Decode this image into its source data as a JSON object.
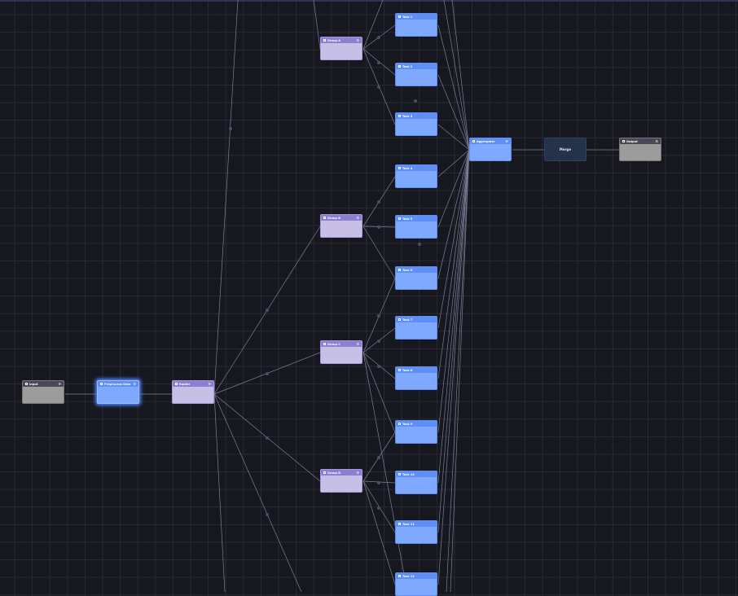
{
  "canvas": {
    "accent": "#5f8ef5",
    "background": "#17171f"
  },
  "nodes": {
    "input": {
      "title": "Input",
      "desc": ""
    },
    "preprocess": {
      "title": "Preprocess Data",
      "desc": ""
    },
    "router": {
      "title": "Router",
      "desc": ""
    },
    "group_a": {
      "title": "Group A",
      "desc": ""
    },
    "group_b": {
      "title": "Group B",
      "desc": ""
    },
    "group_c": {
      "title": "Group C",
      "desc": ""
    },
    "group_d": {
      "title": "Group D",
      "desc": ""
    },
    "task_1": {
      "title": "Task 1",
      "desc": ""
    },
    "task_2": {
      "title": "Task 2",
      "desc": ""
    },
    "task_3": {
      "title": "Task 3",
      "desc": ""
    },
    "task_4": {
      "title": "Task 4",
      "desc": ""
    },
    "task_5": {
      "title": "Task 5",
      "desc": ""
    },
    "task_6": {
      "title": "Task 6",
      "desc": ""
    },
    "task_7": {
      "title": "Task 7",
      "desc": ""
    },
    "task_8": {
      "title": "Task 8",
      "desc": ""
    },
    "task_9": {
      "title": "Task 9",
      "desc": ""
    },
    "task_10": {
      "title": "Task 10",
      "desc": ""
    },
    "task_11": {
      "title": "Task 11",
      "desc": ""
    },
    "task_12": {
      "title": "Task 12",
      "desc": ""
    },
    "aggregator": {
      "title": "Aggregator",
      "desc": ""
    },
    "merge": {
      "title": "Merge",
      "desc": ""
    },
    "output": {
      "title": "Output",
      "desc": ""
    }
  },
  "icons": {
    "node": "node-icon",
    "settings": "gear-icon"
  }
}
